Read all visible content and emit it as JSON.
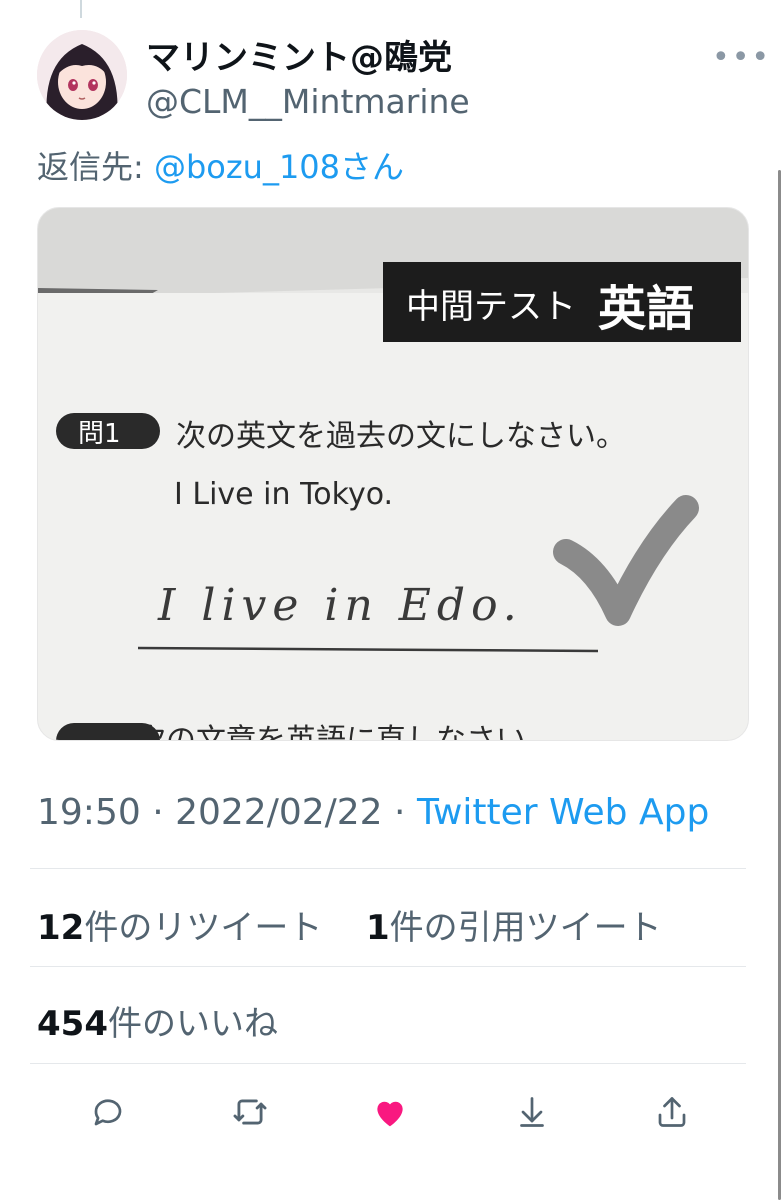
{
  "tweet": {
    "display_name": "マリンミント@鴎党",
    "handle": "@CLM__Mintmarine",
    "reply_prefix": "返信先: ",
    "reply_to": "@bozu_108さん",
    "more_icon": "more-icon",
    "time": "19:50",
    "sep1": " · ",
    "date": "2022/02/22",
    "sep2": " · ",
    "source": "Twitter Web App"
  },
  "media": {
    "header_small": "中間テスト",
    "header_big": "英語",
    "q1_label": "問1",
    "q1_text": "次の英文を過去の文にしなさい。",
    "q1_sentence": "I Live in Tokyo.",
    "answer": "I live in Edo.",
    "q2_text": "次の文章を英語に直しなさい"
  },
  "stats": {
    "retweets_count": "12",
    "retweets_label": "件のリツイート",
    "quotes_count": "1",
    "quotes_label": "件の引用ツイート",
    "likes_count": "454",
    "likes_label": "件のいいね"
  },
  "actions": {
    "reply_icon": "reply-icon",
    "retweet_icon": "retweet-icon",
    "like_icon": "heart-icon",
    "bookmark_icon": "bookmark-down-icon",
    "share_icon": "share-icon",
    "like_color": "#f91880"
  }
}
